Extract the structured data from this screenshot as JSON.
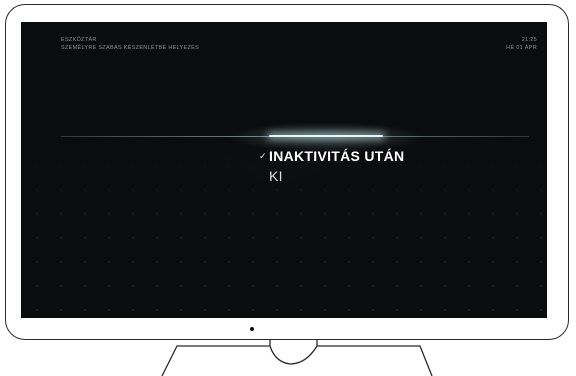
{
  "header": {
    "breadcrumb": "ESZKÖZTÁR",
    "subtitle": "SZEMÉLYRE SZABÁS KÉSZENLÉTBE HELYEZÉS",
    "time": "21:25",
    "date": "HÉ 01 ÁPR"
  },
  "menu": {
    "options": [
      {
        "label": "INAKTIVITÁS UTÁN",
        "selected": true,
        "check_icon": "checkmark-icon"
      },
      {
        "label": "KI",
        "selected": false
      }
    ]
  },
  "colors": {
    "screen_bg": "#0a0c0d",
    "highlight": "#e8f4f6",
    "muted_text": "#8a9499"
  }
}
